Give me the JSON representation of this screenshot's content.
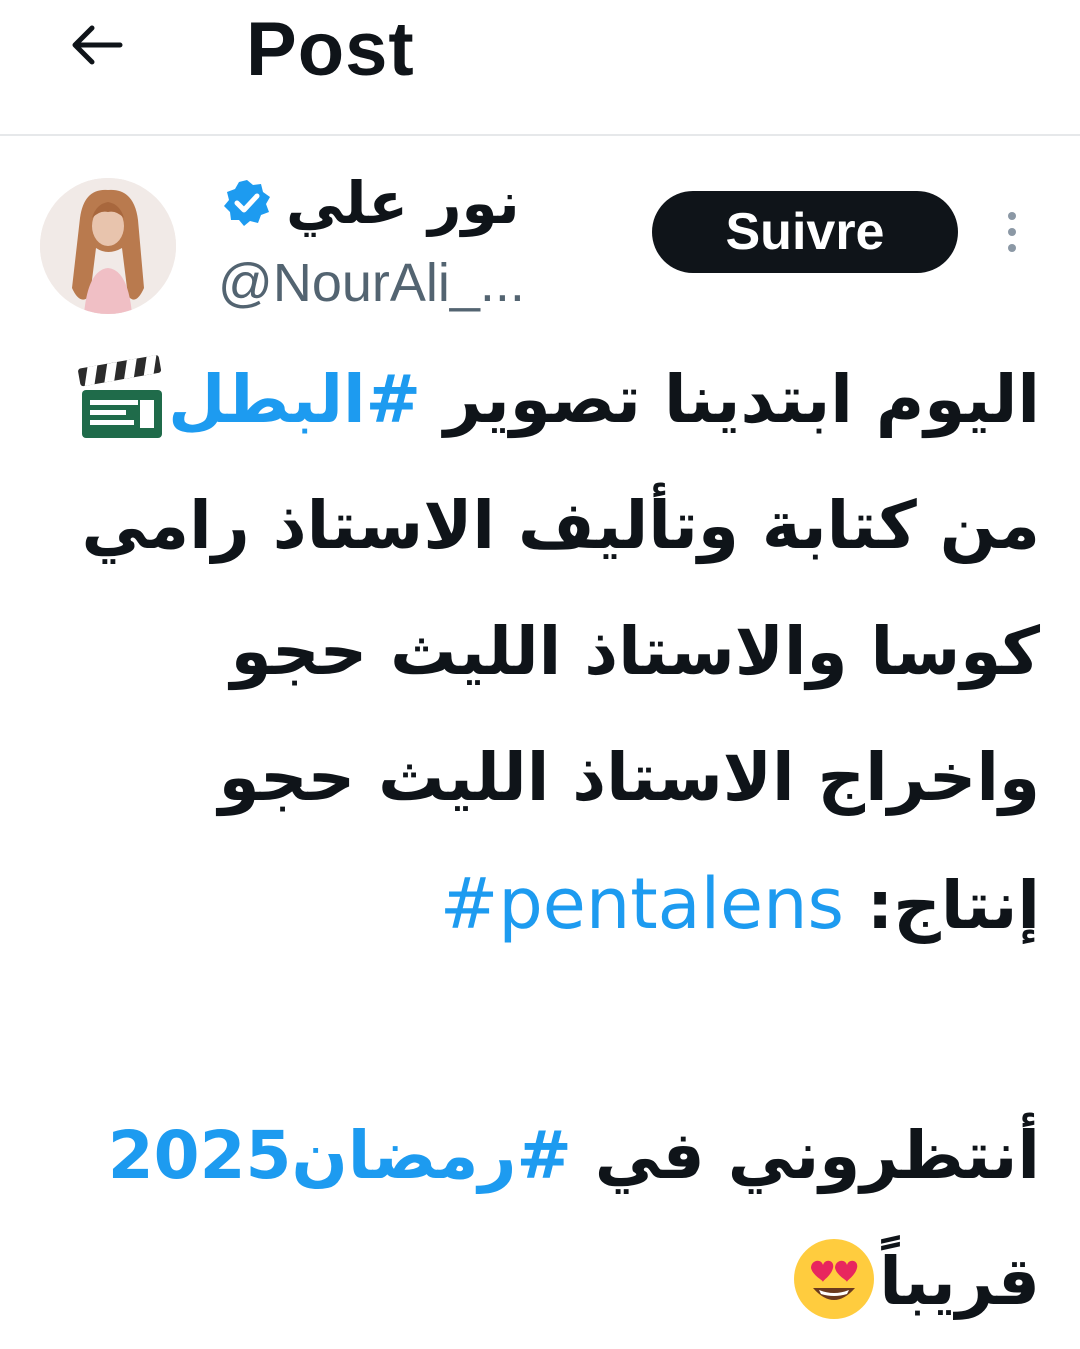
{
  "header": {
    "back_icon": "arrow-left-icon",
    "title": "Post"
  },
  "author": {
    "display_name": "نور علي",
    "handle": "@NourAli_...",
    "verified_icon": "verified-badge-icon",
    "verified_color": "#1d9bf0"
  },
  "actions": {
    "follow_label": "Suivre",
    "more_icon": "more-vertical-icon"
  },
  "tweet": {
    "line1_text": "اليوم ابتدينا تصوير ",
    "line1_hashtag": "#البطل",
    "line1_emoji": "clapper-board-emoji",
    "line2": "من كتابة وتأليف الاستاذ رامي",
    "line3": "كوسا والاستاذ الليث حجو",
    "line4": "واخراج الاستاذ الليث حجو",
    "line5_text": "إنتاج: ",
    "line5_hashtag": "#pentalens",
    "line6_text": "أنتظروني في ",
    "line6_hashtag": "#رمضان2025",
    "line7_text": "قريباً",
    "line7_emoji": "heart-eyes-emoji",
    "link_color": "#1d9bf0"
  }
}
